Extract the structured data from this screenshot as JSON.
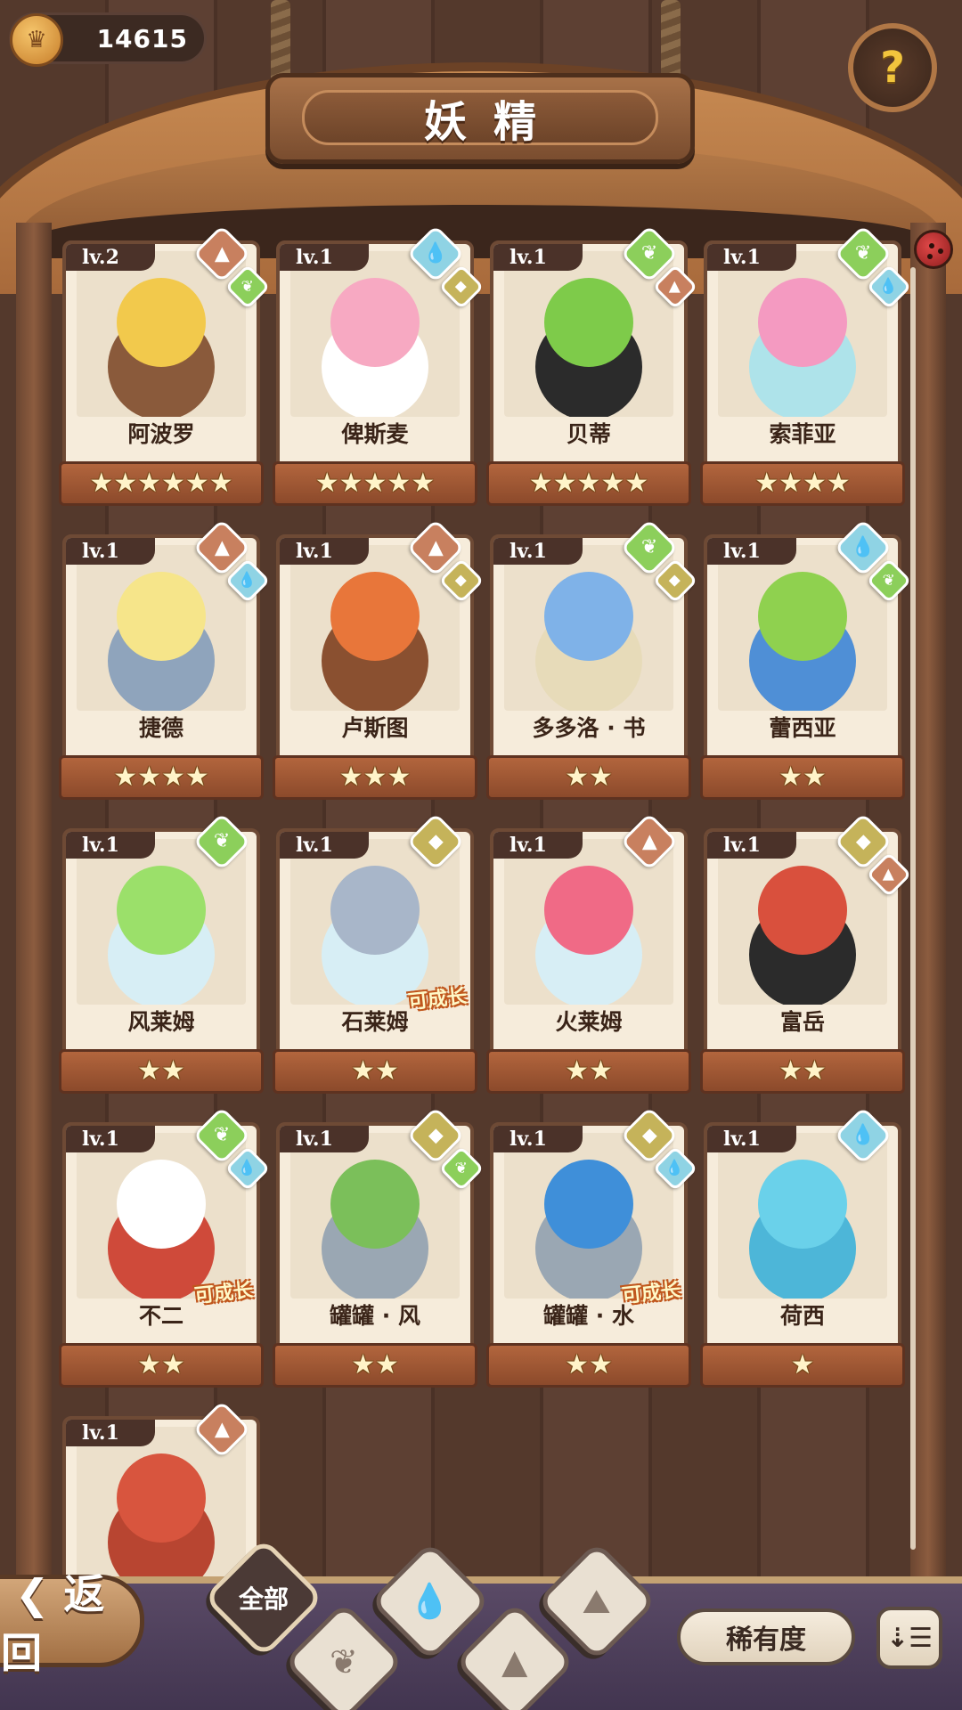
{
  "header": {
    "coins": "14615",
    "title": "妖精",
    "help_icon": "question-sprout-icon"
  },
  "colors": {
    "fire": "#c8805f",
    "water": "#8fd3e4",
    "wood": "#8ccf5b",
    "earth": "#c5b35a"
  },
  "spirits": [
    {
      "level": "lv.2",
      "name": "阿波罗",
      "stars": "★★★★★★",
      "elements": [
        "fire",
        "wood"
      ],
      "growable": false
    },
    {
      "level": "lv.1",
      "name": "俾斯麦",
      "stars": "★★★★★",
      "elements": [
        "water",
        "earth"
      ],
      "growable": false
    },
    {
      "level": "lv.1",
      "name": "贝蒂",
      "stars": "★★★★★",
      "elements": [
        "wood",
        "fire"
      ],
      "growable": false
    },
    {
      "level": "lv.1",
      "name": "索菲亚",
      "stars": "★★★★",
      "elements": [
        "wood",
        "water"
      ],
      "growable": false
    },
    {
      "level": "lv.1",
      "name": "捷德",
      "stars": "★★★★",
      "elements": [
        "fire",
        "water"
      ],
      "growable": false
    },
    {
      "level": "lv.1",
      "name": "卢斯图",
      "stars": "★★★",
      "elements": [
        "fire",
        "earth"
      ],
      "growable": false
    },
    {
      "level": "lv.1",
      "name": "多多洛 · 书",
      "stars": "★★",
      "elements": [
        "wood",
        "earth"
      ],
      "growable": false
    },
    {
      "level": "lv.1",
      "name": "蕾西亚",
      "stars": "★★",
      "elements": [
        "water",
        "wood"
      ],
      "growable": false
    },
    {
      "level": "lv.1",
      "name": "风莱姆",
      "stars": "★★",
      "elements": [
        "wood"
      ],
      "growable": false
    },
    {
      "level": "lv.1",
      "name": "石莱姆",
      "stars": "★★",
      "elements": [
        "earth"
      ],
      "growable": true
    },
    {
      "level": "lv.1",
      "name": "火莱姆",
      "stars": "★★",
      "elements": [
        "fire"
      ],
      "growable": false
    },
    {
      "level": "lv.1",
      "name": "富岳",
      "stars": "★★",
      "elements": [
        "earth",
        "fire"
      ],
      "growable": false
    },
    {
      "level": "lv.1",
      "name": "不二",
      "stars": "★★",
      "elements": [
        "wood",
        "water"
      ],
      "growable": true
    },
    {
      "level": "lv.1",
      "name": "罐罐 · 风",
      "stars": "★★",
      "elements": [
        "earth",
        "wood"
      ],
      "growable": false
    },
    {
      "level": "lv.1",
      "name": "罐罐 · 水",
      "stars": "★★",
      "elements": [
        "earth",
        "water"
      ],
      "growable": true
    },
    {
      "level": "lv.1",
      "name": "荷西",
      "stars": "★",
      "elements": [
        "water"
      ],
      "growable": false
    },
    {
      "level": "lv.1",
      "name": "",
      "stars": "",
      "elements": [
        "fire"
      ],
      "growable": false
    }
  ],
  "growable_label": "可成长",
  "footer": {
    "back_label": "返回",
    "filter_all": "全部",
    "filters": [
      "wood-filter-icon",
      "water-filter-icon",
      "earth-filter-icon",
      "fire-filter-icon"
    ],
    "rarity_label": "稀有度",
    "sort_icon": "sort-icon"
  }
}
